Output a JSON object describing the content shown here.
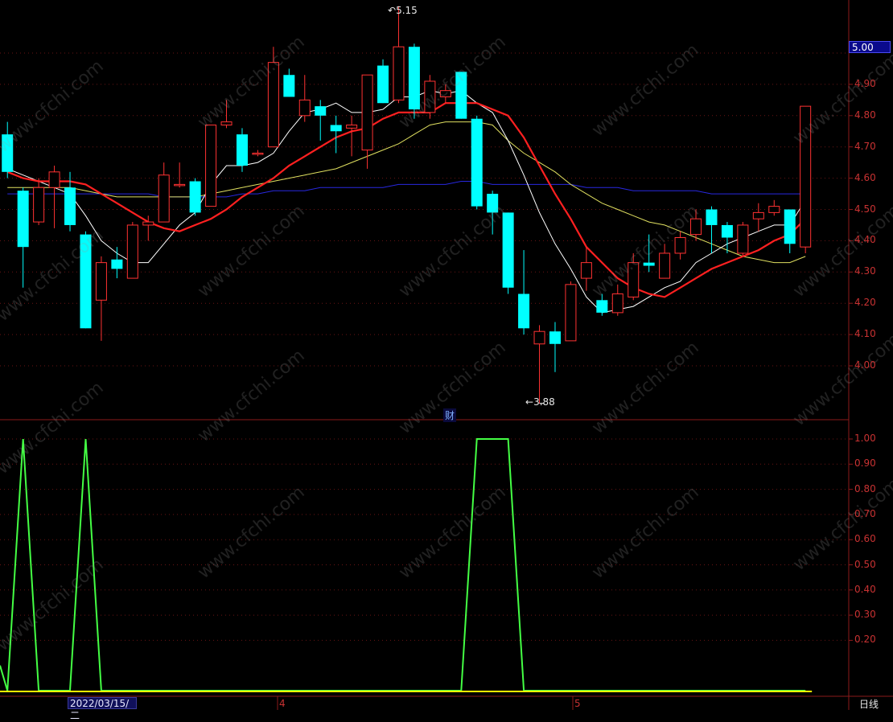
{
  "watermark": "www.cfchi.com",
  "price_panel": {
    "y_ticks": [
      "4.90",
      "4.80",
      "4.70",
      "4.60",
      "4.50",
      "4.40",
      "4.30",
      "4.20",
      "4.10",
      "4.00"
    ],
    "current_price": "5.00",
    "high_label": "5.15",
    "low_label": "3.88",
    "marker_char": "财"
  },
  "indicator_panel": {
    "y_ticks": [
      "1.00",
      "0.90",
      "0.80",
      "0.70",
      "0.60",
      "0.50",
      "0.40",
      "0.30",
      "0.20"
    ]
  },
  "x_axis": {
    "cursor_date": "2022/03/15/二",
    "month_labels": [
      "4",
      "5"
    ],
    "period": "日线"
  },
  "colors": {
    "up": "#ff3232",
    "down": "#00ffff",
    "ma5": "#ffffff",
    "ma10": "#ff2020",
    "ma20": "#e0e060",
    "ma60": "#2828e0",
    "indicator": "#44ff44",
    "baseline": "#ffff00",
    "axis": "#8c1a1a"
  },
  "chart_data": {
    "type": "candlestick",
    "ylim": [
      3.83,
      5.2
    ],
    "candles": [
      {
        "o": 4.74,
        "c": 4.62,
        "h": 4.78,
        "l": 4.6
      },
      {
        "o": 4.56,
        "c": 4.38,
        "h": 4.57,
        "l": 4.25
      },
      {
        "o": 4.46,
        "c": 4.57,
        "h": 4.6,
        "l": 4.45
      },
      {
        "o": 4.57,
        "c": 4.62,
        "h": 4.64,
        "l": 4.44
      },
      {
        "o": 4.57,
        "c": 4.45,
        "h": 4.62,
        "l": 4.43
      },
      {
        "o": 4.42,
        "c": 4.12,
        "h": 4.43,
        "l": 4.12
      },
      {
        "o": 4.21,
        "c": 4.33,
        "h": 4.35,
        "l": 4.08
      },
      {
        "o": 4.34,
        "c": 4.31,
        "h": 4.38,
        "l": 4.28
      },
      {
        "o": 4.28,
        "c": 4.45,
        "h": 4.46,
        "l": 4.28
      },
      {
        "o": 4.45,
        "c": 4.46,
        "h": 4.48,
        "l": 4.4
      },
      {
        "o": 4.46,
        "c": 4.61,
        "h": 4.65,
        "l": 4.46
      },
      {
        "o": 4.58,
        "c": 4.58,
        "h": 4.65,
        "l": 4.57
      },
      {
        "o": 4.59,
        "c": 4.49,
        "h": 4.6,
        "l": 4.48
      },
      {
        "o": 4.51,
        "c": 4.77,
        "h": 4.77,
        "l": 4.51
      },
      {
        "o": 4.77,
        "c": 4.78,
        "h": 4.85,
        "l": 4.76
      },
      {
        "o": 4.74,
        "c": 4.64,
        "h": 4.76,
        "l": 4.62
      },
      {
        "o": 4.68,
        "c": 4.68,
        "h": 4.69,
        "l": 4.67
      },
      {
        "o": 4.7,
        "c": 4.97,
        "h": 5.02,
        "l": 4.7
      },
      {
        "o": 4.93,
        "c": 4.86,
        "h": 4.95,
        "l": 4.86
      },
      {
        "o": 4.8,
        "c": 4.85,
        "h": 4.93,
        "l": 4.78
      },
      {
        "o": 4.83,
        "c": 4.8,
        "h": 4.85,
        "l": 4.72
      },
      {
        "o": 4.77,
        "c": 4.75,
        "h": 4.8,
        "l": 4.68
      },
      {
        "o": 4.76,
        "c": 4.77,
        "h": 4.8,
        "l": 4.67
      },
      {
        "o": 4.69,
        "c": 4.93,
        "h": 4.93,
        "l": 4.63
      },
      {
        "o": 4.96,
        "c": 4.84,
        "h": 4.98,
        "l": 4.84
      },
      {
        "o": 4.85,
        "c": 5.02,
        "h": 5.15,
        "l": 4.84
      },
      {
        "o": 5.02,
        "c": 4.82,
        "h": 5.03,
        "l": 4.79
      },
      {
        "o": 4.81,
        "c": 4.91,
        "h": 4.93,
        "l": 4.79
      },
      {
        "o": 4.86,
        "c": 4.88,
        "h": 4.9,
        "l": 4.84
      },
      {
        "o": 4.94,
        "c": 4.79,
        "h": 4.94,
        "l": 4.79
      },
      {
        "o": 4.79,
        "c": 4.51,
        "h": 4.8,
        "l": 4.5
      },
      {
        "o": 4.55,
        "c": 4.49,
        "h": 4.56,
        "l": 4.42
      },
      {
        "o": 4.49,
        "c": 4.25,
        "h": 4.49,
        "l": 4.23
      },
      {
        "o": 4.23,
        "c": 4.12,
        "h": 4.37,
        "l": 4.1
      },
      {
        "o": 4.07,
        "c": 4.11,
        "h": 4.13,
        "l": 3.88
      },
      {
        "o": 4.11,
        "c": 4.07,
        "h": 4.14,
        "l": 3.98
      },
      {
        "o": 4.08,
        "c": 4.26,
        "h": 4.27,
        "l": 4.08
      },
      {
        "o": 4.28,
        "c": 4.33,
        "h": 4.38,
        "l": 4.24
      },
      {
        "o": 4.21,
        "c": 4.17,
        "h": 4.23,
        "l": 4.16
      },
      {
        "o": 4.17,
        "c": 4.23,
        "h": 4.26,
        "l": 4.16
      },
      {
        "o": 4.22,
        "c": 4.33,
        "h": 4.36,
        "l": 4.21
      },
      {
        "o": 4.33,
        "c": 4.32,
        "h": 4.42,
        "l": 4.3
      },
      {
        "o": 4.28,
        "c": 4.36,
        "h": 4.39,
        "l": 4.28
      },
      {
        "o": 4.36,
        "c": 4.41,
        "h": 4.43,
        "l": 4.34
      },
      {
        "o": 4.42,
        "c": 4.47,
        "h": 4.5,
        "l": 4.4
      },
      {
        "o": 4.5,
        "c": 4.45,
        "h": 4.51,
        "l": 4.36
      },
      {
        "o": 4.45,
        "c": 4.41,
        "h": 4.46,
        "l": 4.36
      },
      {
        "o": 4.36,
        "c": 4.45,
        "h": 4.46,
        "l": 4.35
      },
      {
        "o": 4.47,
        "c": 4.49,
        "h": 4.52,
        "l": 4.43
      },
      {
        "o": 4.49,
        "c": 4.51,
        "h": 4.53,
        "l": 4.48
      },
      {
        "o": 4.5,
        "c": 4.39,
        "h": 4.5,
        "l": 4.36
      },
      {
        "o": 4.38,
        "c": 4.83,
        "h": 4.83,
        "l": 4.36
      }
    ],
    "ma5": [
      4.63,
      4.61,
      4.59,
      4.57,
      4.55,
      4.48,
      4.4,
      4.36,
      4.33,
      4.33,
      4.39,
      4.45,
      4.49,
      4.58,
      4.64,
      4.64,
      4.65,
      4.68,
      4.75,
      4.81,
      4.82,
      4.84,
      4.81,
      4.81,
      4.82,
      4.86,
      4.86,
      4.88,
      4.87,
      4.88,
      4.84,
      4.81,
      4.72,
      4.61,
      4.49,
      4.39,
      4.31,
      4.22,
      4.17,
      4.18,
      4.19,
      4.22,
      4.25,
      4.27,
      4.33,
      4.36,
      4.39,
      4.41,
      4.43,
      4.45,
      4.45,
      4.53
    ],
    "ma10": [
      4.62,
      4.6,
      4.59,
      4.59,
      4.59,
      4.58,
      4.55,
      4.52,
      4.49,
      4.46,
      4.44,
      4.43,
      4.45,
      4.47,
      4.5,
      4.54,
      4.57,
      4.6,
      4.64,
      4.67,
      4.7,
      4.73,
      4.75,
      4.76,
      4.79,
      4.81,
      4.81,
      4.81,
      4.84,
      4.84,
      4.84,
      4.82,
      4.8,
      4.73,
      4.64,
      4.55,
      4.47,
      4.38,
      4.33,
      4.28,
      4.25,
      4.23,
      4.22,
      4.25,
      4.28,
      4.31,
      4.33,
      4.35,
      4.37,
      4.4,
      4.42,
      4.47
    ],
    "ma20": [
      4.57,
      4.57,
      4.57,
      4.57,
      4.57,
      4.56,
      4.55,
      4.54,
      4.54,
      4.54,
      4.54,
      4.54,
      4.54,
      4.55,
      4.56,
      4.57,
      4.58,
      4.59,
      4.6,
      4.61,
      4.62,
      4.63,
      4.65,
      4.67,
      4.69,
      4.71,
      4.74,
      4.77,
      4.78,
      4.78,
      4.78,
      4.77,
      4.72,
      4.68,
      4.65,
      4.62,
      4.58,
      4.55,
      4.52,
      4.5,
      4.48,
      4.46,
      4.45,
      4.43,
      4.41,
      4.39,
      4.37,
      4.35,
      4.34,
      4.33,
      4.33,
      4.35
    ],
    "ma60": [
      4.55,
      4.55,
      4.55,
      4.55,
      4.55,
      4.55,
      4.55,
      4.55,
      4.55,
      4.55,
      4.54,
      4.54,
      4.54,
      4.54,
      4.54,
      4.55,
      4.55,
      4.56,
      4.56,
      4.56,
      4.57,
      4.57,
      4.57,
      4.57,
      4.57,
      4.58,
      4.58,
      4.58,
      4.58,
      4.59,
      4.59,
      4.58,
      4.58,
      4.58,
      4.58,
      4.58,
      4.58,
      4.57,
      4.57,
      4.57,
      4.56,
      4.56,
      4.56,
      4.56,
      4.56,
      4.55,
      4.55,
      4.55,
      4.55,
      4.55,
      4.55,
      4.55
    ],
    "indicator": {
      "ylim": [
        0,
        1.05
      ],
      "values": [
        0,
        1,
        0,
        0,
        0,
        1,
        0,
        0,
        0,
        0,
        0,
        0,
        0,
        0,
        0,
        0,
        0,
        0,
        0,
        0,
        0,
        0,
        0,
        0,
        0,
        0,
        0,
        0,
        0,
        0,
        1,
        1,
        1,
        0,
        0,
        0,
        0,
        0,
        0,
        0,
        0,
        0,
        0,
        0,
        0,
        0,
        0,
        0,
        0,
        0,
        0,
        0
      ]
    }
  }
}
